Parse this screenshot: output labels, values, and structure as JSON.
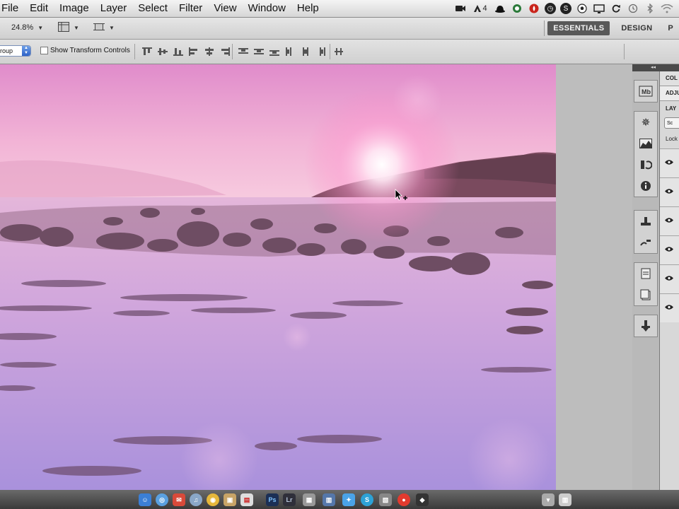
{
  "menubar": {
    "items": [
      "File",
      "Edit",
      "Image",
      "Layer",
      "Select",
      "Filter",
      "View",
      "Window",
      "Help"
    ],
    "status_icons": [
      "video-camera-icon",
      "adobe-updater-icon",
      "bowler-hat-icon",
      "recycle-icon",
      "flame-icon",
      "clock-icon",
      "skype-icon",
      "soccer-ball-icon",
      "display-icon",
      "sync-icon",
      "time-machine-icon",
      "bluetooth-icon",
      "wifi-icon"
    ],
    "adobe_badge_count": "4"
  },
  "appbar": {
    "zoom_value": "24.8%",
    "workspaces": [
      "ESSENTIALS",
      "DESIGN",
      "P"
    ],
    "active_workspace": "ESSENTIALS"
  },
  "options": {
    "auto_select_value": "roup",
    "show_transform_controls": "Show Transform Controls",
    "show_transform_checked": false
  },
  "panels": {
    "tabs": [
      "COL",
      "ADJU"
    ],
    "layers_tab": "LAY",
    "blend_mode_value": "Sc",
    "lock_label": "Lock",
    "layer_count": 6
  },
  "colors": {
    "accent": "#595959",
    "sky_top": "#e59ad0",
    "sky_horizon": "#f6c5dc",
    "water": "#b79ce0"
  }
}
